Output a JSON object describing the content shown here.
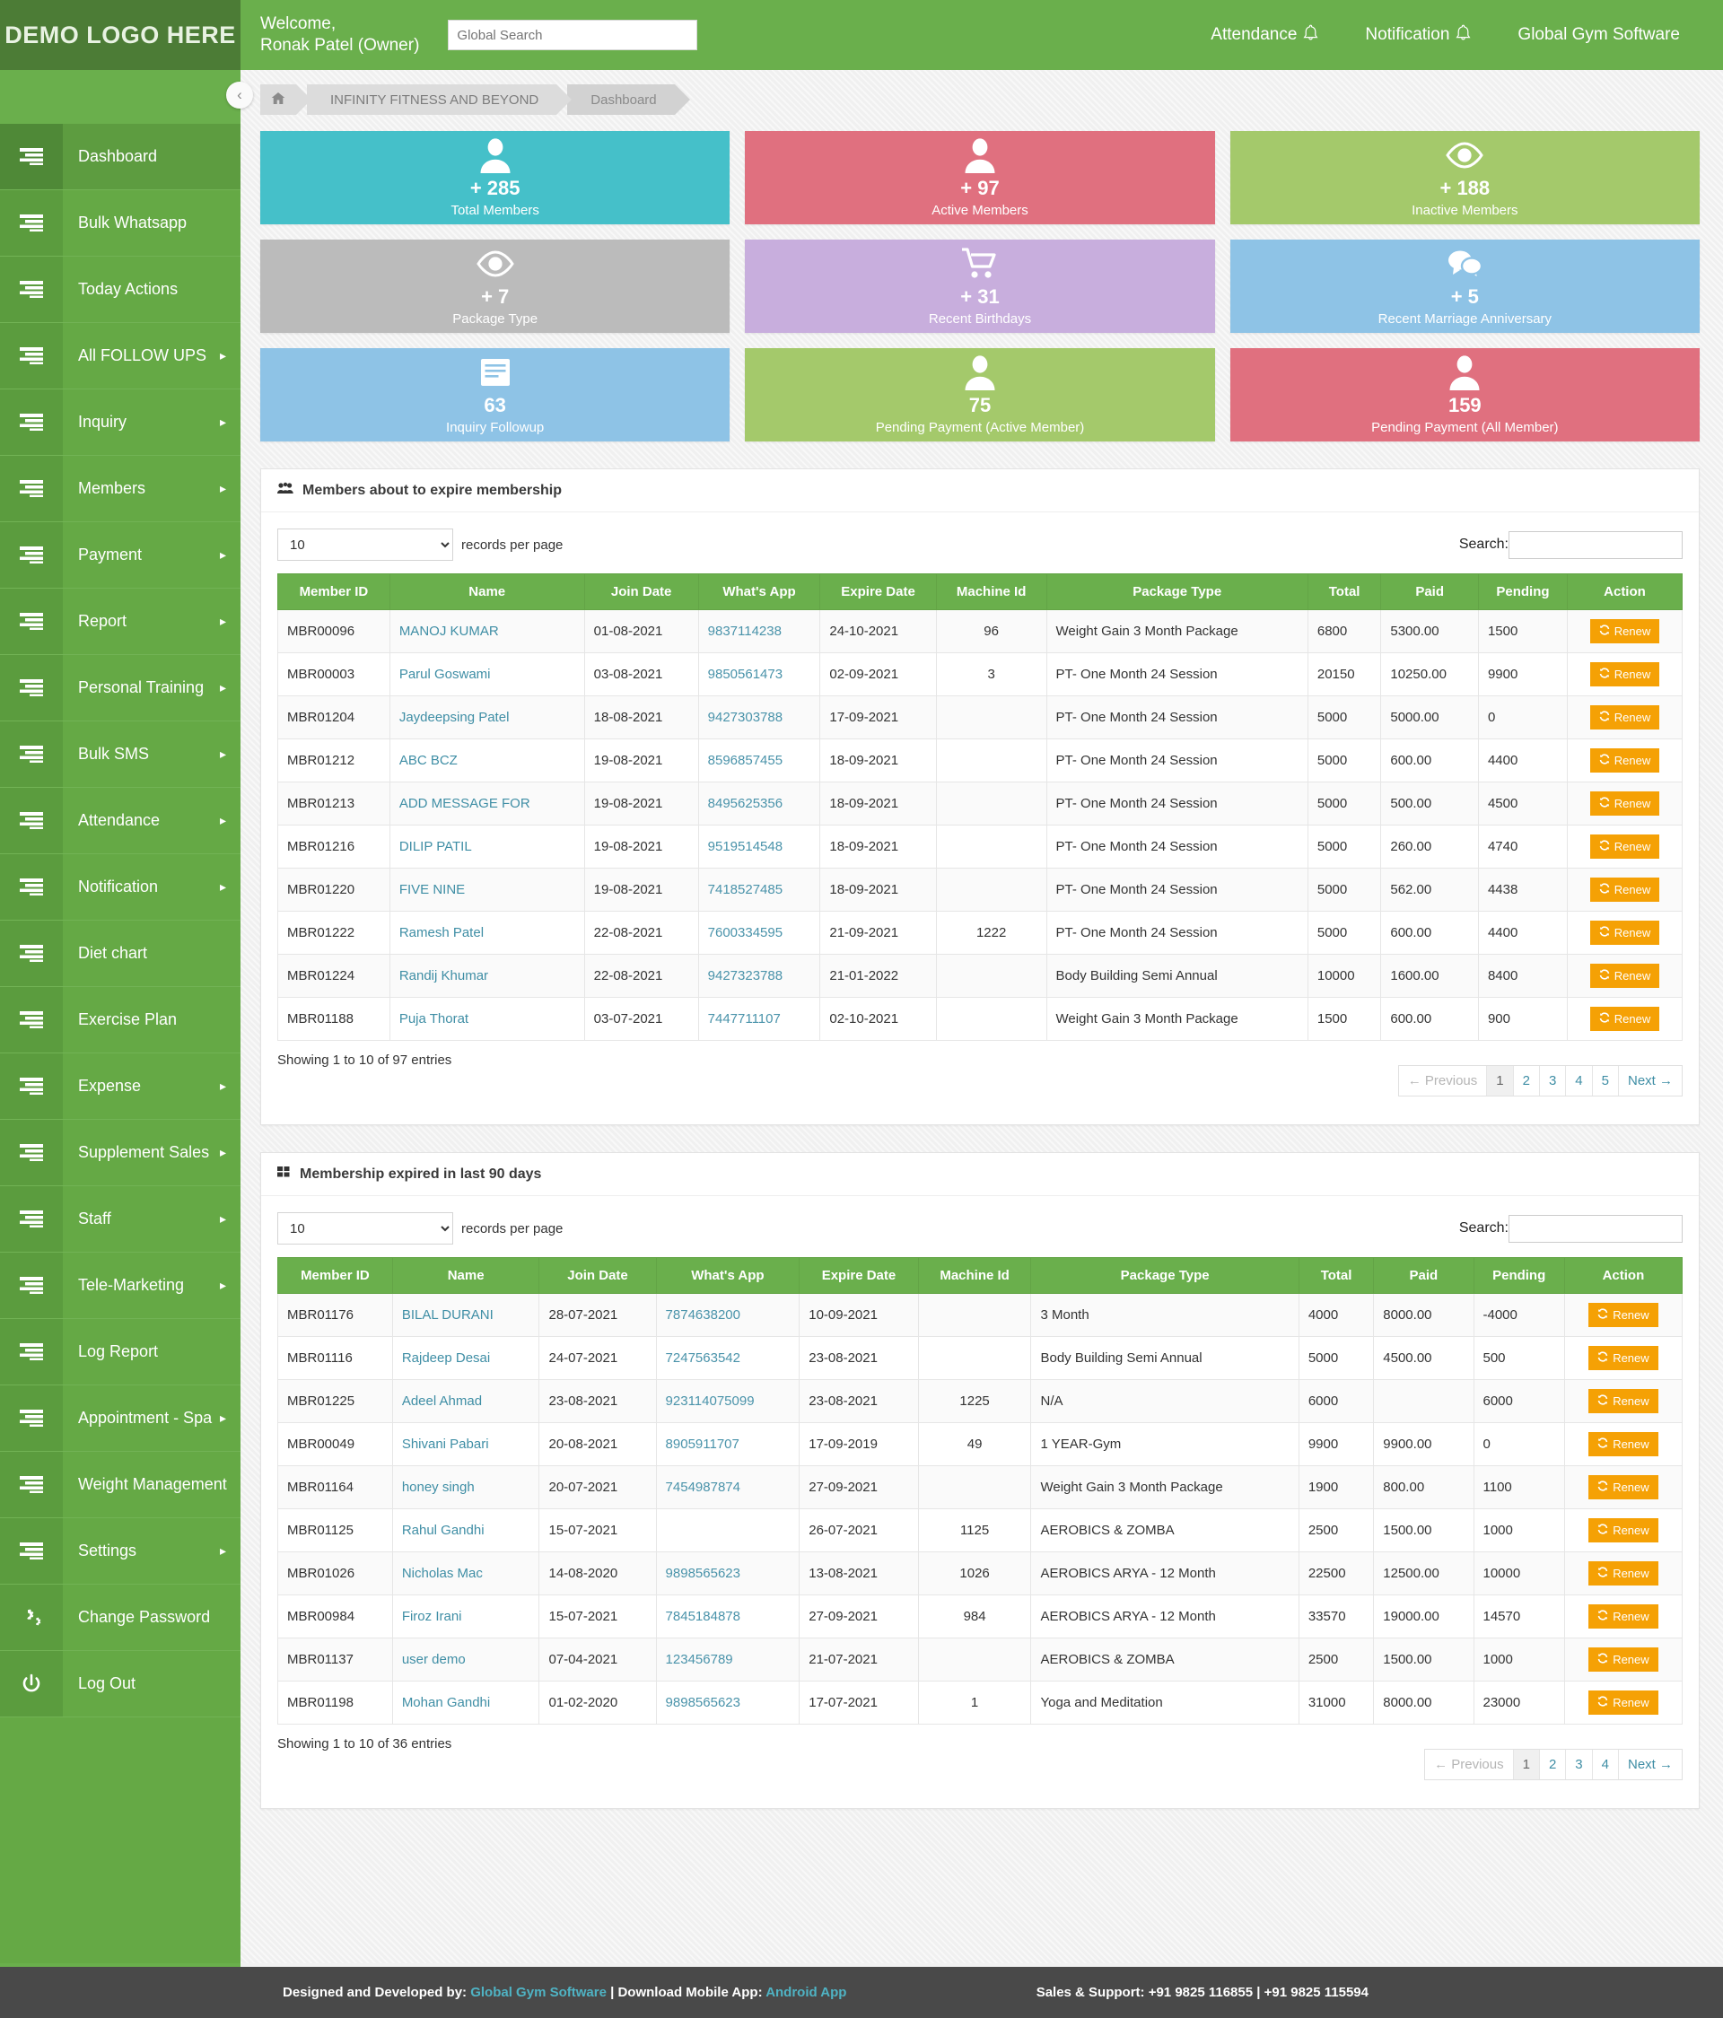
{
  "header": {
    "logo": "DEMO LOGO HERE",
    "welcome": "Welcome,\nRonak Patel (Owner)",
    "search_placeholder": "Global Search",
    "search_value": "",
    "attendance": "Attendance",
    "notification": "Notification",
    "brand": "Global Gym Software"
  },
  "breadcrumb": {
    "home_icon": "home-icon",
    "gym": "INFINITY FITNESS AND BEYOND",
    "page": "Dashboard"
  },
  "sidebar": {
    "collapse_icon": "chevron-left-icon",
    "items": [
      {
        "label": "Dashboard",
        "icon": "list-icon",
        "arrow": "",
        "active": true
      },
      {
        "label": "Bulk Whatsapp",
        "icon": "list-icon",
        "arrow": ""
      },
      {
        "label": "Today Actions",
        "icon": "list-icon",
        "arrow": ""
      },
      {
        "label": "All FOLLOW UPS",
        "icon": "list-icon",
        "arrow": "▸"
      },
      {
        "label": "Inquiry",
        "icon": "list-icon",
        "arrow": "▸"
      },
      {
        "label": "Members",
        "icon": "list-icon",
        "arrow": "▸"
      },
      {
        "label": "Payment",
        "icon": "list-icon",
        "arrow": "▸"
      },
      {
        "label": "Report",
        "icon": "list-icon",
        "arrow": "▸"
      },
      {
        "label": "Personal Training",
        "icon": "list-icon",
        "arrow": "▸"
      },
      {
        "label": "Bulk SMS",
        "icon": "list-icon",
        "arrow": "▸"
      },
      {
        "label": "Attendance",
        "icon": "list-icon",
        "arrow": "▸"
      },
      {
        "label": "Notification",
        "icon": "list-icon",
        "arrow": "▸"
      },
      {
        "label": "Diet chart",
        "icon": "list-icon",
        "arrow": ""
      },
      {
        "label": "Exercise Plan",
        "icon": "list-icon",
        "arrow": ""
      },
      {
        "label": "Expense",
        "icon": "list-icon",
        "arrow": "▸"
      },
      {
        "label": "Supplement Sales",
        "icon": "list-icon",
        "arrow": "▸"
      },
      {
        "label": "Staff",
        "icon": "list-icon",
        "arrow": "▸"
      },
      {
        "label": "Tele-Marketing",
        "icon": "list-icon",
        "arrow": "▸"
      },
      {
        "label": "Log Report",
        "icon": "list-icon",
        "arrow": ""
      },
      {
        "label": "Appointment - Spa",
        "icon": "list-icon",
        "arrow": "▸"
      },
      {
        "label": "Weight Management",
        "icon": "list-icon",
        "arrow": ""
      },
      {
        "label": "Settings",
        "icon": "list-icon",
        "arrow": "▸"
      },
      {
        "label": "Change Password",
        "icon": "gears-icon",
        "arrow": ""
      },
      {
        "label": "Log Out",
        "icon": "power-icon",
        "arrow": ""
      }
    ]
  },
  "cards": [
    {
      "num": "+ 285",
      "label": "Total Members",
      "color": "#45c0c9",
      "icon": "user-icon"
    },
    {
      "num": "+ 97",
      "label": "Active Members",
      "color": "#e0707f",
      "icon": "user-icon"
    },
    {
      "num": "+ 188",
      "label": "Inactive Members",
      "color": "#a4c96b",
      "icon": "eye-icon"
    },
    {
      "num": "+ 7",
      "label": "Package Type",
      "color": "#bbbbbb",
      "icon": "eye-icon"
    },
    {
      "num": "+ 31",
      "label": "Recent Birthdays",
      "color": "#c8aedd",
      "icon": "cart-icon"
    },
    {
      "num": "+ 5",
      "label": "Recent Marriage Anniversary",
      "color": "#8ec3e6",
      "icon": "chat-icon"
    },
    {
      "num": "63",
      "label": "Inquiry Followup",
      "color": "#8ec3e6",
      "icon": "book-icon"
    },
    {
      "num": "75",
      "label": "Pending Payment (Active Member)",
      "color": "#a4c96b",
      "icon": "user-icon"
    },
    {
      "num": "159",
      "label": "Pending Payment (All Member)",
      "color": "#e0707f",
      "icon": "user-icon"
    }
  ],
  "table_common": {
    "length_value": "10",
    "length_label": "records per page",
    "search_label": "Search:",
    "search_value": "",
    "columns": [
      "Member ID",
      "Name",
      "Join Date",
      "What's App",
      "Expire Date",
      "Machine Id",
      "Package Type",
      "Total",
      "Paid",
      "Pending",
      "Action"
    ],
    "renew_label": "Renew",
    "renew_icon": "refresh-icon",
    "prev_label": "← Previous",
    "next_label": "Next →"
  },
  "panel1": {
    "icon": "users-group-icon",
    "title": "Members about to expire membership",
    "showing": "Showing 1 to 10 of 97 entries",
    "pages": [
      "1",
      "2",
      "3",
      "4",
      "5"
    ],
    "current_page": "1",
    "rows": [
      {
        "id": "MBR00096",
        "name": "MANOJ KUMAR",
        "join": "01-08-2021",
        "wa": "9837114238",
        "expire": "24-10-2021",
        "machine": "96",
        "pkg": "Weight Gain 3 Month Package",
        "total": "6800",
        "paid": "5300.00",
        "pending": "1500"
      },
      {
        "id": "MBR00003",
        "name": "Parul Goswami",
        "join": "03-08-2021",
        "wa": "9850561473",
        "expire": "02-09-2021",
        "machine": "3",
        "pkg": "PT- One Month 24 Session",
        "total": "20150",
        "paid": "10250.00",
        "pending": "9900"
      },
      {
        "id": "MBR01204",
        "name": "Jaydeepsing Patel",
        "join": "18-08-2021",
        "wa": "9427303788",
        "expire": "17-09-2021",
        "machine": "",
        "pkg": "PT- One Month 24 Session",
        "total": "5000",
        "paid": "5000.00",
        "pending": "0"
      },
      {
        "id": "MBR01212",
        "name": "ABC BCZ",
        "join": "19-08-2021",
        "wa": "8596857455",
        "expire": "18-09-2021",
        "machine": "",
        "pkg": "PT- One Month 24 Session",
        "total": "5000",
        "paid": "600.00",
        "pending": "4400"
      },
      {
        "id": "MBR01213",
        "name": "ADD MESSAGE FOR",
        "join": "19-08-2021",
        "wa": "8495625356",
        "expire": "18-09-2021",
        "machine": "",
        "pkg": "PT- One Month 24 Session",
        "total": "5000",
        "paid": "500.00",
        "pending": "4500"
      },
      {
        "id": "MBR01216",
        "name": "DILIP PATIL",
        "join": "19-08-2021",
        "wa": "9519514548",
        "expire": "18-09-2021",
        "machine": "",
        "pkg": "PT- One Month 24 Session",
        "total": "5000",
        "paid": "260.00",
        "pending": "4740"
      },
      {
        "id": "MBR01220",
        "name": "FIVE NINE",
        "join": "19-08-2021",
        "wa": "7418527485",
        "expire": "18-09-2021",
        "machine": "",
        "pkg": "PT- One Month 24 Session",
        "total": "5000",
        "paid": "562.00",
        "pending": "4438"
      },
      {
        "id": "MBR01222",
        "name": "Ramesh Patel",
        "join": "22-08-2021",
        "wa": "7600334595",
        "expire": "21-09-2021",
        "machine": "1222",
        "pkg": "PT- One Month 24 Session",
        "total": "5000",
        "paid": "600.00",
        "pending": "4400"
      },
      {
        "id": "MBR01224",
        "name": "Randij Khumar",
        "join": "22-08-2021",
        "wa": "9427323788",
        "expire": "21-01-2022",
        "machine": "",
        "pkg": "Body Building Semi Annual",
        "total": "10000",
        "paid": "1600.00",
        "pending": "8400"
      },
      {
        "id": "MBR01188",
        "name": "Puja Thorat",
        "join": "03-07-2021",
        "wa": "7447711107",
        "expire": "02-10-2021",
        "machine": "",
        "pkg": "Weight Gain 3 Month Package",
        "total": "1500",
        "paid": "600.00",
        "pending": "900"
      }
    ]
  },
  "panel2": {
    "icon": "grid-icon",
    "title": "Membership expired in last 90 days",
    "showing": "Showing 1 to 10 of 36 entries",
    "pages": [
      "1",
      "2",
      "3",
      "4"
    ],
    "current_page": "1",
    "rows": [
      {
        "id": "MBR01176",
        "name": "BILAL DURANI",
        "join": "28-07-2021",
        "wa": "7874638200",
        "expire": "10-09-2021",
        "machine": "",
        "pkg": "3 Month",
        "total": "4000",
        "paid": "8000.00",
        "pending": "-4000"
      },
      {
        "id": "MBR01116",
        "name": "Rajdeep Desai",
        "join": "24-07-2021",
        "wa": "7247563542",
        "expire": "23-08-2021",
        "machine": "",
        "pkg": "Body Building Semi Annual",
        "total": "5000",
        "paid": "4500.00",
        "pending": "500"
      },
      {
        "id": "MBR01225",
        "name": "Adeel Ahmad",
        "join": "23-08-2021",
        "wa": "923114075099",
        "expire": "23-08-2021",
        "machine": "1225",
        "pkg": "N/A",
        "total": "6000",
        "paid": "",
        "pending": "6000"
      },
      {
        "id": "MBR00049",
        "name": "Shivani Pabari",
        "join": "20-08-2021",
        "wa": "8905911707",
        "expire": "17-09-2019",
        "machine": "49",
        "pkg": "1 YEAR-Gym",
        "total": "9900",
        "paid": "9900.00",
        "pending": "0"
      },
      {
        "id": "MBR01164",
        "name": "honey singh",
        "join": "20-07-2021",
        "wa": "7454987874",
        "expire": "27-09-2021",
        "machine": "",
        "pkg": "Weight Gain 3 Month Package",
        "total": "1900",
        "paid": "800.00",
        "pending": "1100"
      },
      {
        "id": "MBR01125",
        "name": "Rahul Gandhi",
        "join": "15-07-2021",
        "wa": "",
        "expire": "26-07-2021",
        "machine": "1125",
        "pkg": "AEROBICS & ZOMBA",
        "total": "2500",
        "paid": "1500.00",
        "pending": "1000"
      },
      {
        "id": "MBR01026",
        "name": "Nicholas Mac",
        "join": "14-08-2020",
        "wa": "9898565623",
        "expire": "13-08-2021",
        "machine": "1026",
        "pkg": "AEROBICS ARYA - 12 Month",
        "total": "22500",
        "paid": "12500.00",
        "pending": "10000"
      },
      {
        "id": "MBR00984",
        "name": "Firoz Irani",
        "join": "15-07-2021",
        "wa": "7845184878",
        "expire": "27-09-2021",
        "machine": "984",
        "pkg": "AEROBICS ARYA - 12 Month",
        "total": "33570",
        "paid": "19000.00",
        "pending": "14570"
      },
      {
        "id": "MBR01137",
        "name": "user demo",
        "join": "07-04-2021",
        "wa": "123456789",
        "expire": "21-07-2021",
        "machine": "",
        "pkg": "AEROBICS & ZOMBA",
        "total": "2500",
        "paid": "1500.00",
        "pending": "1000"
      },
      {
        "id": "MBR01198",
        "name": "Mohan Gandhi",
        "join": "01-02-2020",
        "wa": "9898565623",
        "expire": "17-07-2021",
        "machine": "1",
        "pkg": "Yoga and Meditation",
        "total": "31000",
        "paid": "8000.00",
        "pending": "23000"
      }
    ]
  },
  "footer": {
    "designed_by": "Designed and Developed by:",
    "company": "Global Gym Software",
    "separator": "|",
    "download_label": "Download Mobile App:",
    "android": "Android App",
    "support": "Sales & Support: +91 9825 116855 | +91 9825 115594"
  }
}
